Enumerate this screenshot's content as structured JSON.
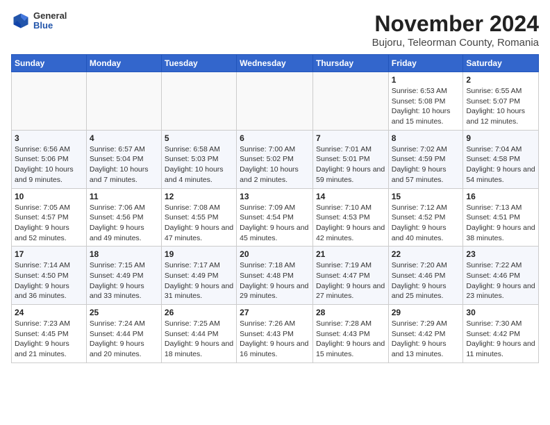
{
  "header": {
    "logo_general": "General",
    "logo_blue": "Blue",
    "title": "November 2024",
    "subtitle": "Bujoru, Teleorman County, Romania"
  },
  "weekdays": [
    "Sunday",
    "Monday",
    "Tuesday",
    "Wednesday",
    "Thursday",
    "Friday",
    "Saturday"
  ],
  "weeks": [
    [
      {
        "day": "",
        "info": ""
      },
      {
        "day": "",
        "info": ""
      },
      {
        "day": "",
        "info": ""
      },
      {
        "day": "",
        "info": ""
      },
      {
        "day": "",
        "info": ""
      },
      {
        "day": "1",
        "info": "Sunrise: 6:53 AM\nSunset: 5:08 PM\nDaylight: 10 hours and 15 minutes."
      },
      {
        "day": "2",
        "info": "Sunrise: 6:55 AM\nSunset: 5:07 PM\nDaylight: 10 hours and 12 minutes."
      }
    ],
    [
      {
        "day": "3",
        "info": "Sunrise: 6:56 AM\nSunset: 5:06 PM\nDaylight: 10 hours and 9 minutes."
      },
      {
        "day": "4",
        "info": "Sunrise: 6:57 AM\nSunset: 5:04 PM\nDaylight: 10 hours and 7 minutes."
      },
      {
        "day": "5",
        "info": "Sunrise: 6:58 AM\nSunset: 5:03 PM\nDaylight: 10 hours and 4 minutes."
      },
      {
        "day": "6",
        "info": "Sunrise: 7:00 AM\nSunset: 5:02 PM\nDaylight: 10 hours and 2 minutes."
      },
      {
        "day": "7",
        "info": "Sunrise: 7:01 AM\nSunset: 5:01 PM\nDaylight: 9 hours and 59 minutes."
      },
      {
        "day": "8",
        "info": "Sunrise: 7:02 AM\nSunset: 4:59 PM\nDaylight: 9 hours and 57 minutes."
      },
      {
        "day": "9",
        "info": "Sunrise: 7:04 AM\nSunset: 4:58 PM\nDaylight: 9 hours and 54 minutes."
      }
    ],
    [
      {
        "day": "10",
        "info": "Sunrise: 7:05 AM\nSunset: 4:57 PM\nDaylight: 9 hours and 52 minutes."
      },
      {
        "day": "11",
        "info": "Sunrise: 7:06 AM\nSunset: 4:56 PM\nDaylight: 9 hours and 49 minutes."
      },
      {
        "day": "12",
        "info": "Sunrise: 7:08 AM\nSunset: 4:55 PM\nDaylight: 9 hours and 47 minutes."
      },
      {
        "day": "13",
        "info": "Sunrise: 7:09 AM\nSunset: 4:54 PM\nDaylight: 9 hours and 45 minutes."
      },
      {
        "day": "14",
        "info": "Sunrise: 7:10 AM\nSunset: 4:53 PM\nDaylight: 9 hours and 42 minutes."
      },
      {
        "day": "15",
        "info": "Sunrise: 7:12 AM\nSunset: 4:52 PM\nDaylight: 9 hours and 40 minutes."
      },
      {
        "day": "16",
        "info": "Sunrise: 7:13 AM\nSunset: 4:51 PM\nDaylight: 9 hours and 38 minutes."
      }
    ],
    [
      {
        "day": "17",
        "info": "Sunrise: 7:14 AM\nSunset: 4:50 PM\nDaylight: 9 hours and 36 minutes."
      },
      {
        "day": "18",
        "info": "Sunrise: 7:15 AM\nSunset: 4:49 PM\nDaylight: 9 hours and 33 minutes."
      },
      {
        "day": "19",
        "info": "Sunrise: 7:17 AM\nSunset: 4:49 PM\nDaylight: 9 hours and 31 minutes."
      },
      {
        "day": "20",
        "info": "Sunrise: 7:18 AM\nSunset: 4:48 PM\nDaylight: 9 hours and 29 minutes."
      },
      {
        "day": "21",
        "info": "Sunrise: 7:19 AM\nSunset: 4:47 PM\nDaylight: 9 hours and 27 minutes."
      },
      {
        "day": "22",
        "info": "Sunrise: 7:20 AM\nSunset: 4:46 PM\nDaylight: 9 hours and 25 minutes."
      },
      {
        "day": "23",
        "info": "Sunrise: 7:22 AM\nSunset: 4:46 PM\nDaylight: 9 hours and 23 minutes."
      }
    ],
    [
      {
        "day": "24",
        "info": "Sunrise: 7:23 AM\nSunset: 4:45 PM\nDaylight: 9 hours and 21 minutes."
      },
      {
        "day": "25",
        "info": "Sunrise: 7:24 AM\nSunset: 4:44 PM\nDaylight: 9 hours and 20 minutes."
      },
      {
        "day": "26",
        "info": "Sunrise: 7:25 AM\nSunset: 4:44 PM\nDaylight: 9 hours and 18 minutes."
      },
      {
        "day": "27",
        "info": "Sunrise: 7:26 AM\nSunset: 4:43 PM\nDaylight: 9 hours and 16 minutes."
      },
      {
        "day": "28",
        "info": "Sunrise: 7:28 AM\nSunset: 4:43 PM\nDaylight: 9 hours and 15 minutes."
      },
      {
        "day": "29",
        "info": "Sunrise: 7:29 AM\nSunset: 4:42 PM\nDaylight: 9 hours and 13 minutes."
      },
      {
        "day": "30",
        "info": "Sunrise: 7:30 AM\nSunset: 4:42 PM\nDaylight: 9 hours and 11 minutes."
      }
    ]
  ]
}
